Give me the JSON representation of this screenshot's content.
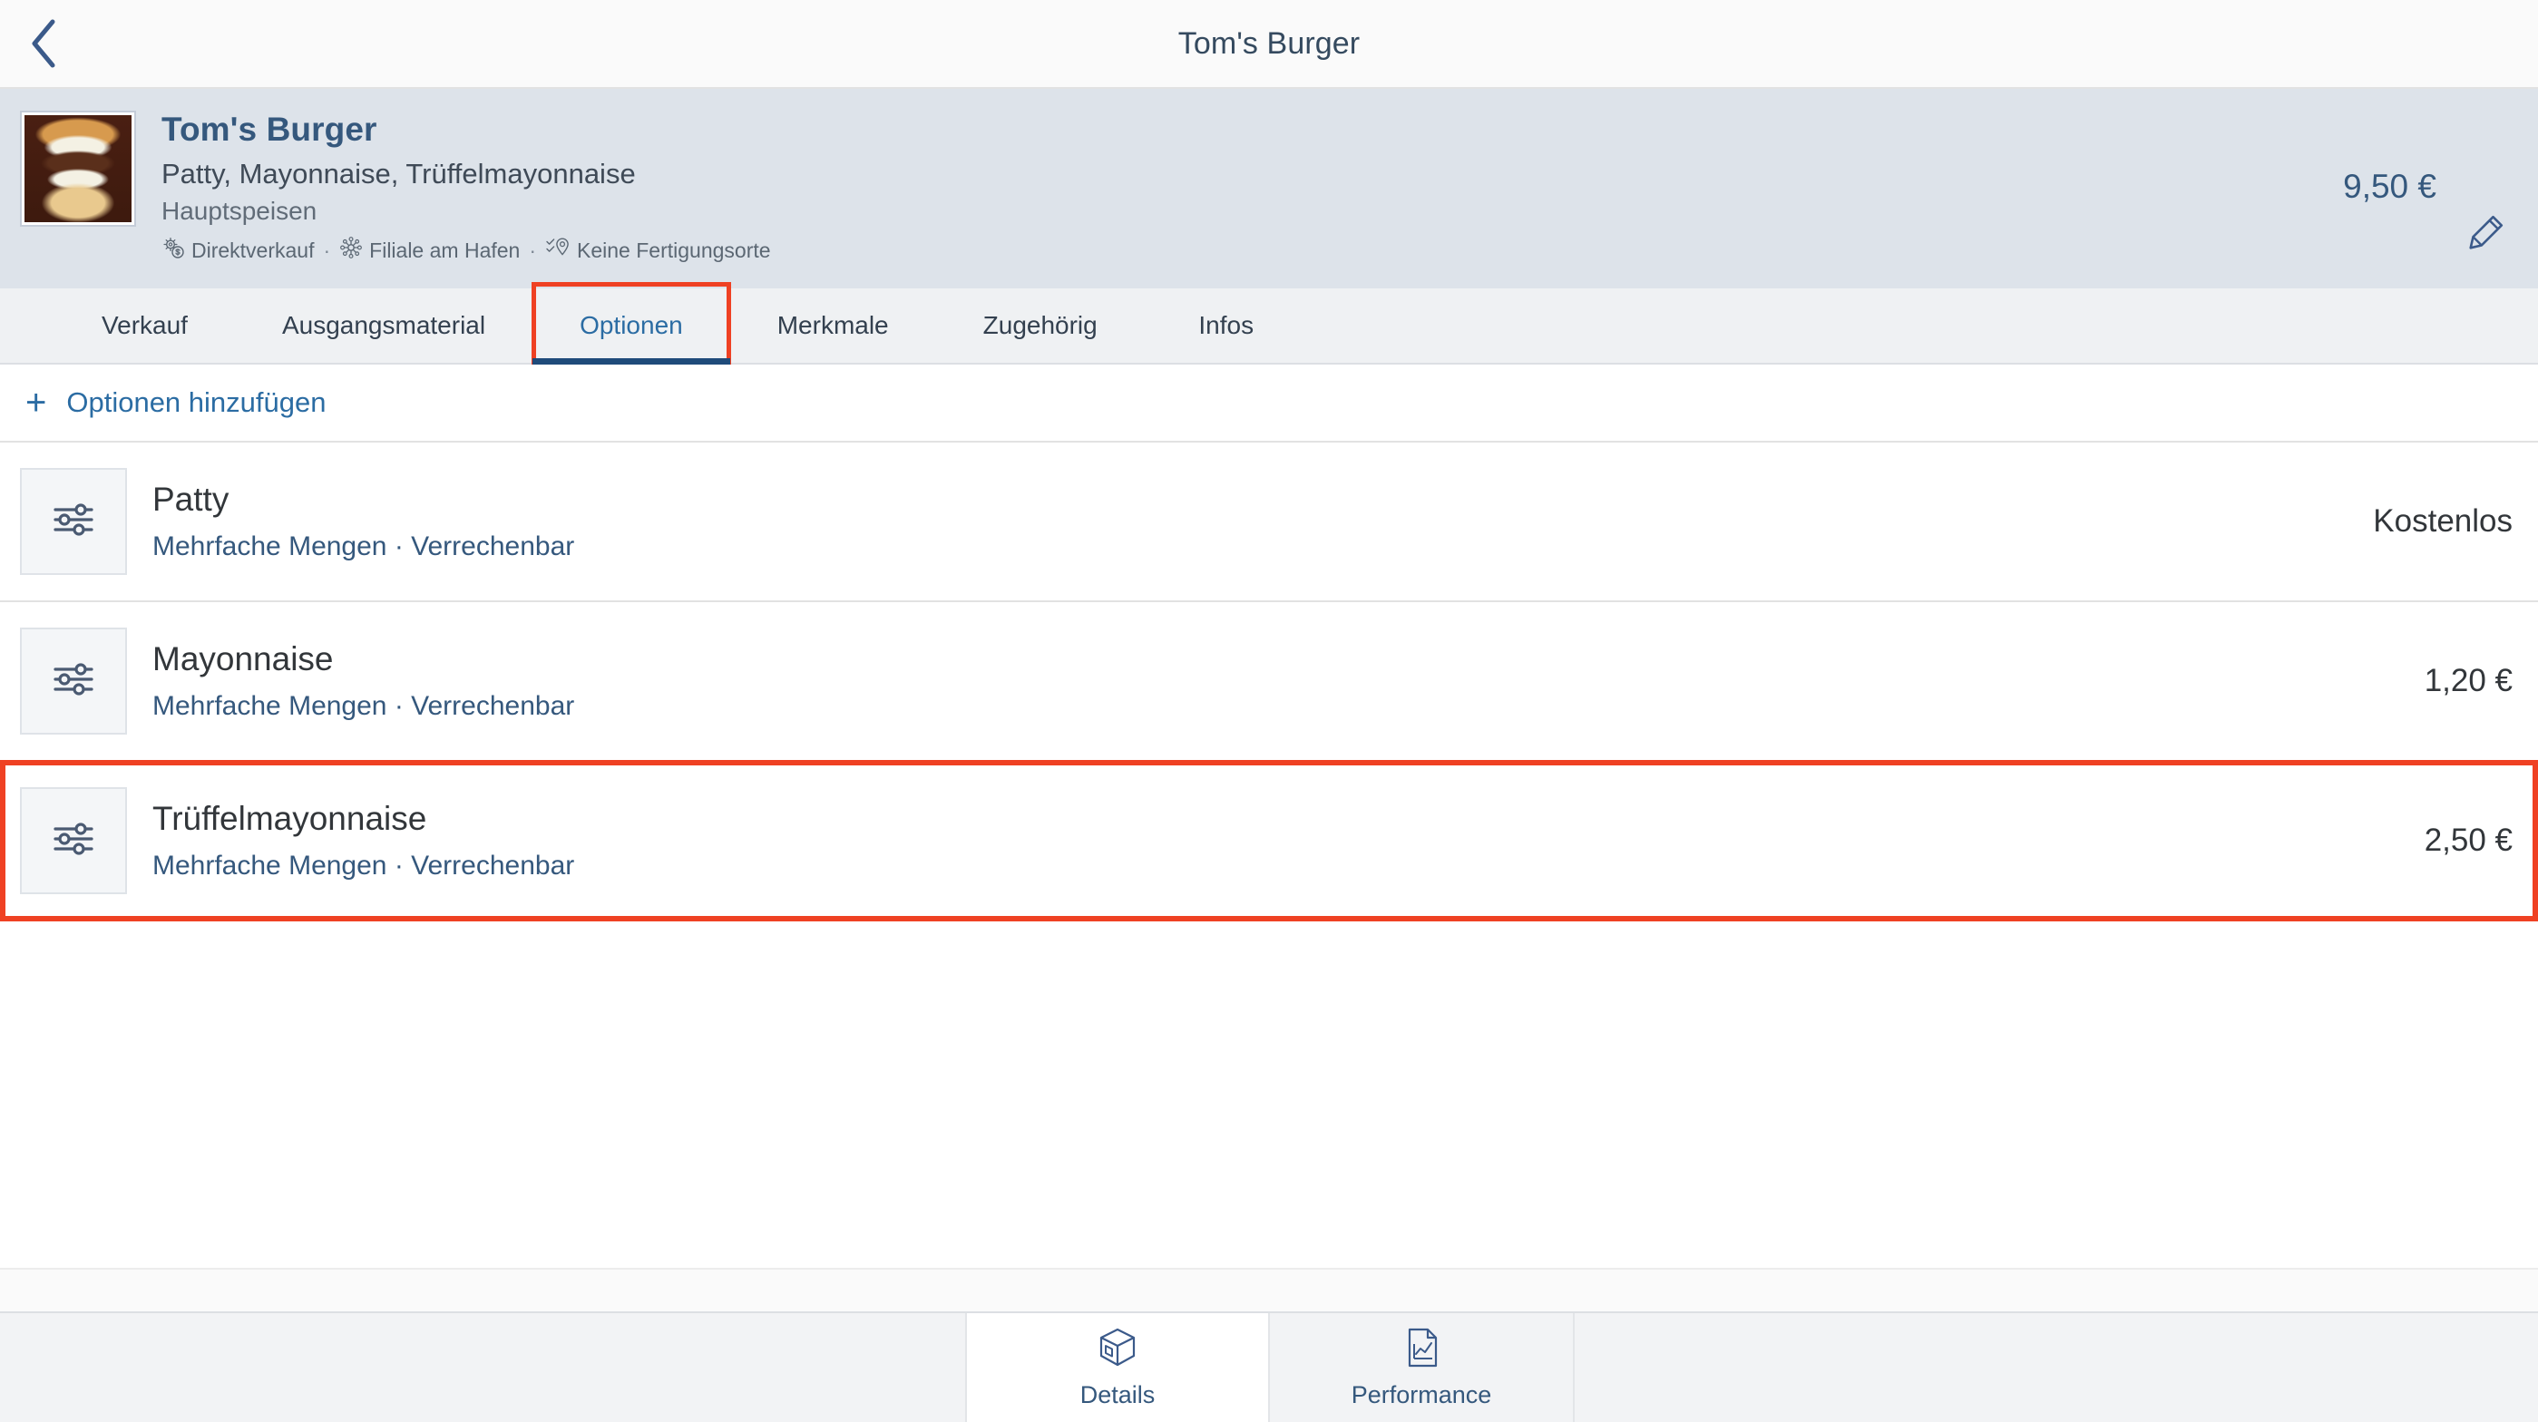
{
  "topbar": {
    "back_icon": "chevron-left-icon",
    "title": "Tom's Burger"
  },
  "object_header": {
    "thumbnail_alt": "burger-photo",
    "title": "Tom's Burger",
    "subtitle": "Patty, Mayonnaise, Trüffelmayonnaise",
    "category": "Hauptspeisen",
    "price": "9,50 €",
    "edit_icon": "pencil-icon",
    "meta": [
      {
        "icon": "gear-currency-icon",
        "label": "Direktverkauf"
      },
      {
        "icon": "network-nodes-icon",
        "label": "Filiale am Hafen"
      },
      {
        "icon": "location-pin-check-icon",
        "label": "Keine Fertigungsorte"
      }
    ],
    "meta_separator": "·"
  },
  "tabs": {
    "items": [
      {
        "label": "Verkauf",
        "active": false
      },
      {
        "label": "Ausgangsmaterial",
        "active": false
      },
      {
        "label": "Optionen",
        "active": true,
        "highlighted": true
      },
      {
        "label": "Merkmale",
        "active": false
      },
      {
        "label": "Zugehörig",
        "active": false
      },
      {
        "label": "Infos",
        "active": false
      }
    ]
  },
  "add_action": {
    "plus": "+",
    "label": "Optionen hinzufügen"
  },
  "options_list": {
    "rows": [
      {
        "icon": "sliders-icon",
        "title": "Patty",
        "subtitle": "Mehrfache Mengen · Verrechenbar",
        "price": "Kostenlos",
        "highlighted": false
      },
      {
        "icon": "sliders-icon",
        "title": "Mayonnaise",
        "subtitle": "Mehrfache Mengen · Verrechenbar",
        "price": "1,20 €",
        "highlighted": false
      },
      {
        "icon": "sliders-icon",
        "title": "Trüffelmayonnaise",
        "subtitle": "Mehrfache Mengen · Verrechenbar",
        "price": "2,50 €",
        "highlighted": true
      }
    ]
  },
  "bottom_nav": {
    "items": [
      {
        "label": "Details",
        "icon": "box-cube-icon",
        "active": true
      },
      {
        "label": "Performance",
        "icon": "chart-document-icon",
        "active": false
      }
    ]
  },
  "colors": {
    "accent_blue": "#35587d",
    "link_blue": "#2b6ca3",
    "highlight_red": "#ef4123",
    "header_bg": "#dde3ea"
  }
}
